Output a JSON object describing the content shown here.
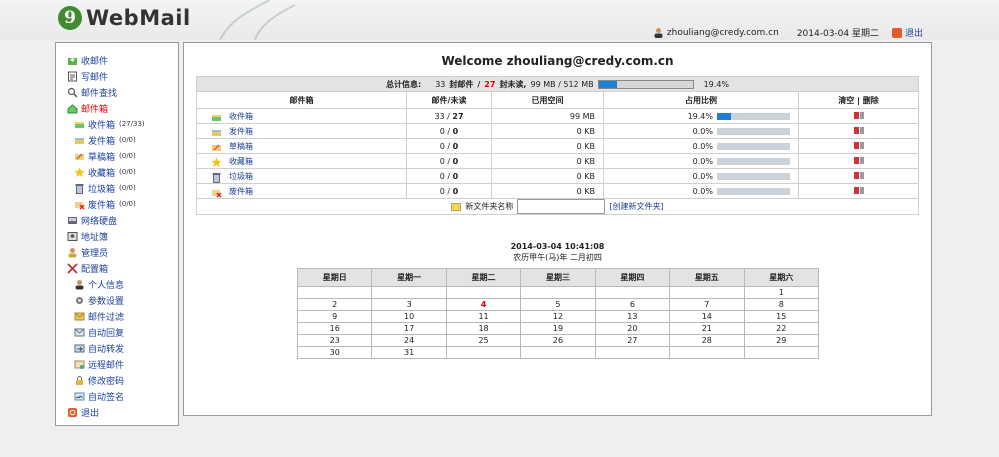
{
  "app": {
    "logo_letter": "9",
    "logo_text": "WebMail"
  },
  "header": {
    "user": "zhouliang@credy.com.cn",
    "date": "2014-03-04 星期二",
    "logout": "退出"
  },
  "sidebar": {
    "items": [
      {
        "label": "收邮件",
        "icon": "inbox-arrow-icon",
        "level": 0
      },
      {
        "label": "写邮件",
        "icon": "compose-icon",
        "level": 0
      },
      {
        "label": "邮件查找",
        "icon": "search-icon",
        "level": 0
      },
      {
        "label": "邮件箱",
        "icon": "home-icon",
        "level": 0,
        "active": true
      },
      {
        "label": "收件箱",
        "count": "(27/33)",
        "icon": "inbox-icon",
        "level": 1
      },
      {
        "label": "发件箱",
        "count": "(0/0)",
        "icon": "outbox-icon",
        "level": 1
      },
      {
        "label": "草稿箱",
        "count": "(0/0)",
        "icon": "draft-icon",
        "level": 1
      },
      {
        "label": "收藏箱",
        "count": "(0/0)",
        "icon": "star-icon",
        "level": 1
      },
      {
        "label": "垃圾箱",
        "count": "(0/0)",
        "icon": "trash-icon",
        "level": 1
      },
      {
        "label": "废件箱",
        "count": "(0/0)",
        "icon": "junk-icon",
        "level": 1
      },
      {
        "label": "网络硬盘",
        "icon": "disk-icon",
        "level": 0
      },
      {
        "label": "地址簿",
        "icon": "address-book-icon",
        "level": 0
      },
      {
        "label": "管理员",
        "icon": "admin-icon",
        "level": 0
      },
      {
        "label": "配置箱",
        "icon": "tools-icon",
        "level": 0
      },
      {
        "label": "个人信息",
        "icon": "person-icon",
        "level": 1
      },
      {
        "label": "参数设置",
        "icon": "gear-icon",
        "level": 1
      },
      {
        "label": "邮件过滤",
        "icon": "filter-icon",
        "level": 1
      },
      {
        "label": "自动回复",
        "icon": "auto-reply-icon",
        "level": 1
      },
      {
        "label": "自动转发",
        "icon": "forward-icon",
        "level": 1
      },
      {
        "label": "远程邮件",
        "icon": "remote-mail-icon",
        "level": 1
      },
      {
        "label": "修改密码",
        "icon": "lock-icon",
        "level": 1
      },
      {
        "label": "自动签名",
        "icon": "signature-icon",
        "level": 1
      },
      {
        "label": "退出",
        "icon": "exit-icon",
        "level": 0
      }
    ]
  },
  "main": {
    "welcome": "Welcome zhouliang@credy.com.cn",
    "summary": {
      "label": "总计信息:",
      "mail_total": "33",
      "mail_unit": "封邮件",
      "slash": "/",
      "unread": "27",
      "unread_unit": "封未读,",
      "space": "99 MB / 512 MB",
      "percent": "19.4%",
      "percent_value": 19.4
    },
    "columns": [
      "邮件箱",
      "邮件/未读",
      "已用空间",
      "占用比例",
      "清空 | 删除"
    ],
    "folders": [
      {
        "name": "收件箱",
        "mails": "33",
        "unread": "27",
        "space": "99 MB",
        "ratio": "19.4%",
        "ratio_value": 19.4,
        "icon": "inbox-icon"
      },
      {
        "name": "发件箱",
        "mails": "0",
        "unread": "0",
        "space": "0 KB",
        "ratio": "0.0%",
        "ratio_value": 0,
        "icon": "outbox-icon"
      },
      {
        "name": "草稿箱",
        "mails": "0",
        "unread": "0",
        "space": "0 KB",
        "ratio": "0.0%",
        "ratio_value": 0,
        "icon": "draft-icon"
      },
      {
        "name": "收藏箱",
        "mails": "0",
        "unread": "0",
        "space": "0 KB",
        "ratio": "0.0%",
        "ratio_value": 0,
        "icon": "star-icon"
      },
      {
        "name": "垃圾箱",
        "mails": "0",
        "unread": "0",
        "space": "0 KB",
        "ratio": "0.0%",
        "ratio_value": 0,
        "icon": "trash-icon"
      },
      {
        "name": "废件箱",
        "mails": "0",
        "unread": "0",
        "space": "0 KB",
        "ratio": "0.0%",
        "ratio_value": 0,
        "icon": "junk-icon"
      }
    ],
    "new_folder": {
      "label": "新文件夹名称",
      "value": "",
      "create_link": "[创建新文件夹]"
    },
    "clock": "2014-03-04 10:41:08",
    "lunar": "农历甲午(马)年 二月初四"
  },
  "calendar": {
    "weekdays": [
      "星期日",
      "星期一",
      "星期二",
      "星期三",
      "星期四",
      "星期五",
      "星期六"
    ],
    "today": "4",
    "weeks": [
      [
        "",
        "",
        "",
        "",
        "",
        "",
        "1"
      ],
      [
        "2",
        "3",
        "4",
        "5",
        "6",
        "7",
        "8"
      ],
      [
        "9",
        "10",
        "11",
        "12",
        "13",
        "14",
        "15"
      ],
      [
        "16",
        "17",
        "18",
        "19",
        "20",
        "21",
        "22"
      ],
      [
        "23",
        "24",
        "25",
        "26",
        "27",
        "28",
        "29"
      ],
      [
        "30",
        "31",
        "",
        "",
        "",
        "",
        ""
      ]
    ]
  },
  "colors": {
    "accent": "#1d7fd6",
    "link": "#1a3f9a",
    "alert": "#d00000",
    "brand_green": "#3f8b2f"
  }
}
